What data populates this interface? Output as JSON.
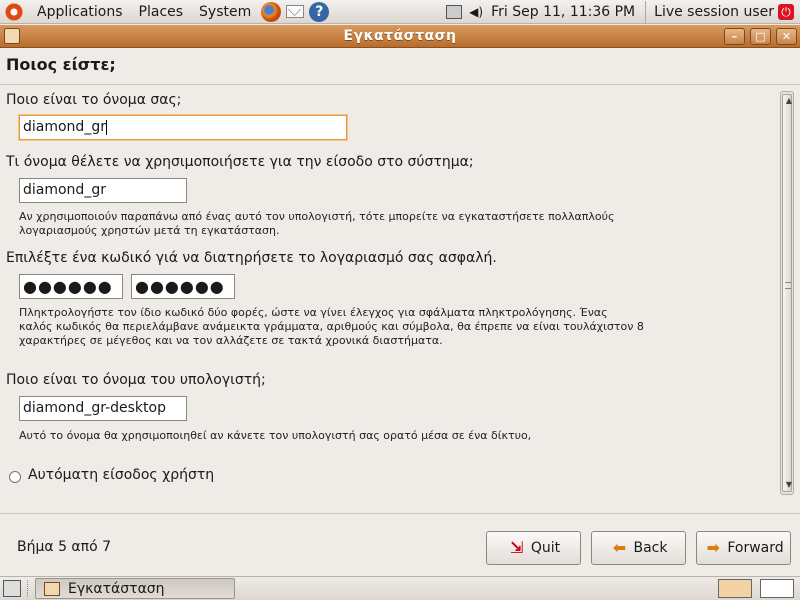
{
  "top_panel": {
    "menus": [
      "Applications",
      "Places",
      "System"
    ],
    "clock": "Fri Sep 11, 11:36 PM",
    "user": "Live session user"
  },
  "window": {
    "title": "Εγκατάσταση"
  },
  "page": {
    "heading": "Ποιος είστε;",
    "name_question": "Ποιο είναι το όνομα σας;",
    "name_value": "diamond_gr",
    "login_question": "Τι όνομα θέλετε να χρησιμοποιήσετε για την είσοδο στο σύστημα;",
    "login_value": "diamond_gr",
    "login_hint_1": "Αν χρησιμοποιούν παραπάνω από ένας αυτό τον υπολογιστή, τότε μπορείτε να εγκαταστήσετε πολλαπλούς",
    "login_hint_2": "λογαριασμούς χρηστών μετά τη εγκατάσταση.",
    "password_question": "Επιλέξτε ένα κωδικό γιά να διατηρήσετε το λογαριασμό σας ασφαλή.",
    "password_value": "●●●●●●",
    "password_confirm_value": "●●●●●●",
    "password_hint_1": "Πληκτρολογήστε τον ίδιο κωδικό δύο φορές, ώστε να γίνει έλεγχος για σφάλματα πληκτρολόγησης. Ένας",
    "password_hint_2": "καλός κωδικός θα περιελάμβανε ανάμεικτα γράμματα, αριθμούς και σύμβολα, θα έπρεπε να είναι τουλάχιστον 8",
    "password_hint_3": "χαρακτήρες σε μέγεθος και να τον αλλάζετε σε τακτά χρονικά διαστήματα.",
    "computer_question": "Ποιο είναι το όνομα του υπολογιστή;",
    "computer_value": "diamond_gr-desktop",
    "computer_hint": "Αυτό το όνομα θα χρησιμοποιηθεί αν κάνετε τον υπολογιστή σας ορατό μέσα σε ένα δίκτυο,",
    "autologin_label": "Αυτόματη είσοδος χρήστη",
    "autologin_checked": false
  },
  "footer": {
    "step": "Βήμα 5 από 7",
    "quit_label": "Quit",
    "back_label": "Back",
    "forward_label": "Forward"
  },
  "bottom_panel": {
    "task_label": "Εγκατάσταση"
  },
  "icons": [
    "ubuntu-logo-icon",
    "firefox-icon",
    "mail-icon",
    "help-icon",
    "network-icon",
    "volume-icon",
    "power-icon",
    "quit-icon",
    "back-arrow-icon",
    "forward-arrow-icon"
  ]
}
